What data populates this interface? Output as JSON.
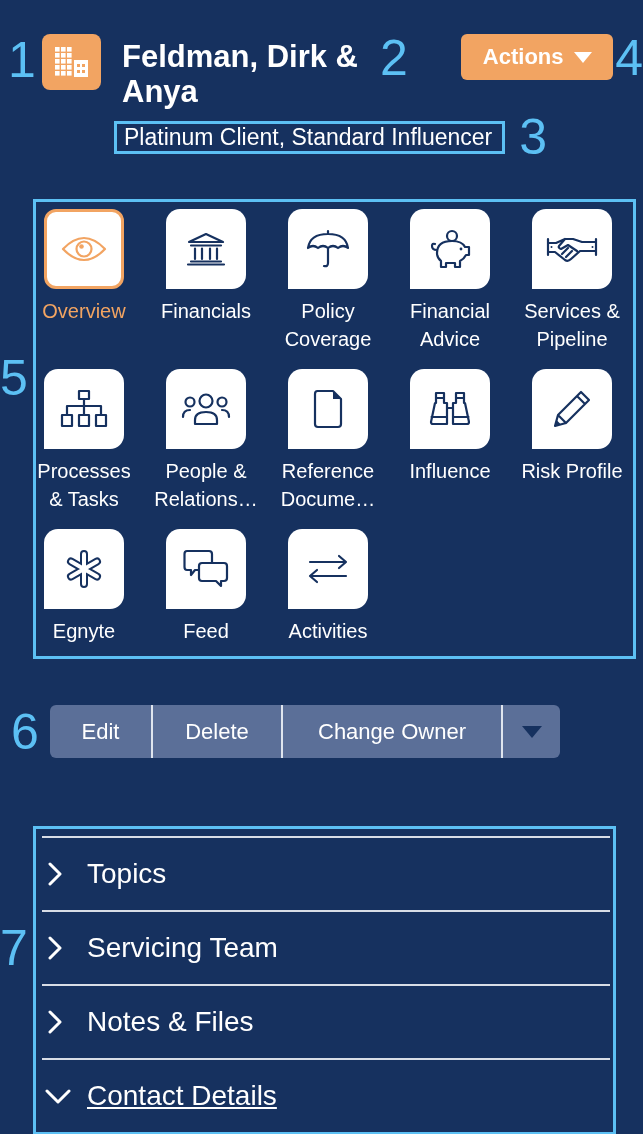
{
  "record_header": {
    "icon_callout": "1",
    "title": "Feldman, Dirk & Anya",
    "title_callout": "2",
    "subtitle": "Platinum Client, Standard Influencer",
    "subtitle_highlighted": true,
    "subtitle_callout": "3",
    "actions_button": {
      "label": "Actions",
      "callout": "4"
    }
  },
  "app_launcher": {
    "callout": "5",
    "highlighted": true,
    "items": [
      {
        "label": "Overview",
        "selected": true
      },
      {
        "label": "Financials",
        "selected": false
      },
      {
        "label": "Policy Coverage",
        "selected": false
      },
      {
        "label": "Financial Advice",
        "selected": false
      },
      {
        "label": "Services & Pipeline",
        "selected": false
      },
      {
        "label": "Processes & Tasks",
        "selected": false
      },
      {
        "label": "People & Relations…",
        "selected": false
      },
      {
        "label": "Reference Docume…",
        "selected": false
      },
      {
        "label": "Influence",
        "selected": false
      },
      {
        "label": "Risk Profile",
        "selected": false
      },
      {
        "label": "Egnyte",
        "selected": false
      },
      {
        "label": "Feed",
        "selected": false
      },
      {
        "label": "Activities",
        "selected": false
      }
    ]
  },
  "action_bar": {
    "callout": "6",
    "buttons": [
      {
        "label": "Edit"
      },
      {
        "label": "Delete"
      },
      {
        "label": "Change Owner"
      }
    ]
  },
  "sections": {
    "callout": "7",
    "highlighted": true,
    "items": [
      {
        "label": "Topics",
        "expanded": false
      },
      {
        "label": "Servicing Team",
        "expanded": false
      },
      {
        "label": "Notes & Files",
        "expanded": false
      },
      {
        "label": "Contact Details",
        "expanded": true
      }
    ]
  }
}
